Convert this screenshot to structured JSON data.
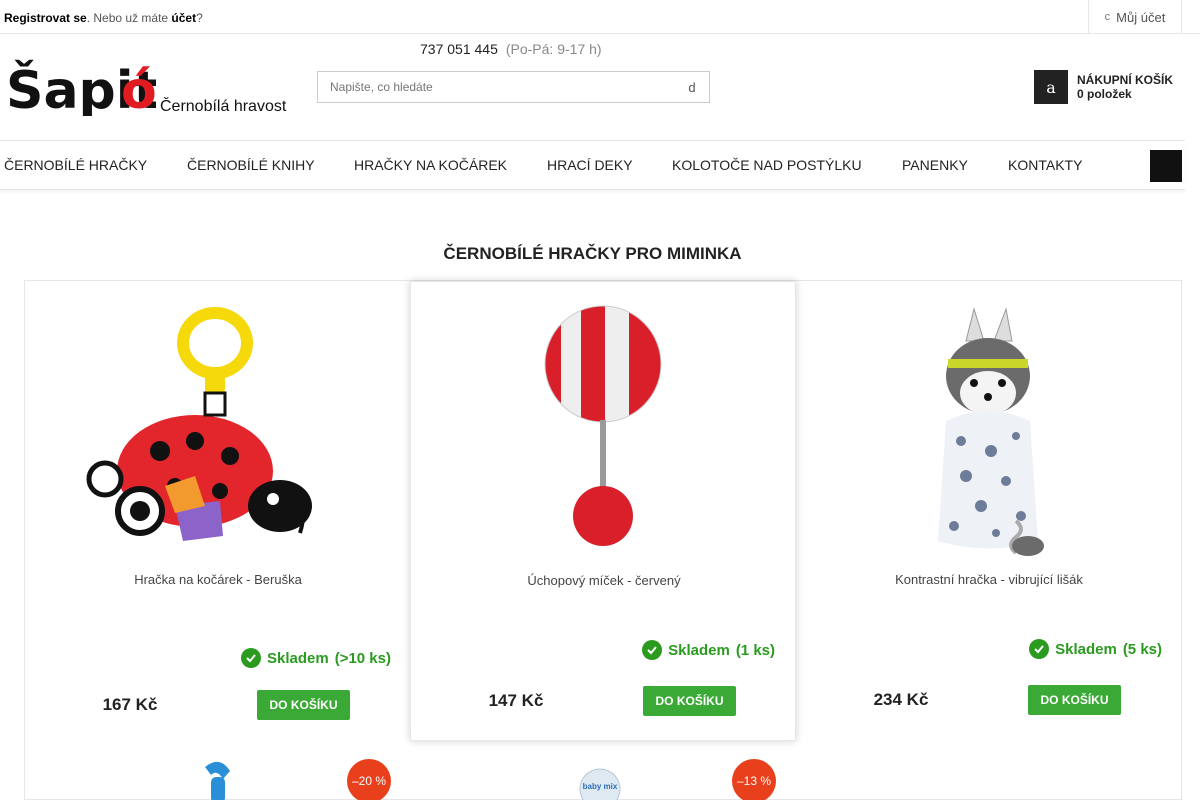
{
  "topbar": {
    "register_link": "Registrovat se",
    "middle_text": ". Nebo už máte ",
    "account_link": "účet",
    "end_text": "?",
    "my_account_icon": "c",
    "my_account": "Můj účet"
  },
  "header": {
    "phone_icon": "",
    "phone": "737 051 445",
    "hours": "(Po-Pá: 9-17 h)",
    "logo_tagline": "Černobílá hravost",
    "search_placeholder": "Napište, co hledáte",
    "search_icon_glyph": "d",
    "cart_icon_glyph": "a",
    "cart_title": "NÁKUPNÍ KOŠÍK",
    "cart_count": "0 položek"
  },
  "nav": {
    "items": [
      "ČERNOBÍLÉ HRAČKY",
      "ČERNOBÍLÉ KNIHY",
      "HRAČKY NA KOČÁREK",
      "HRACÍ DEKY",
      "KOLOTOČE NAD POSTÝLKU",
      "PANENKY",
      "KONTAKTY"
    ],
    "menu_glyph": ""
  },
  "section": {
    "title": "ČERNOBÍLÉ HRAČKY PRO MIMINKA"
  },
  "products": [
    {
      "name": "Hračka na kočárek - Beruška",
      "rating_glyphs": "",
      "stock_label": "Skladem",
      "stock_count": "(>10 ks)",
      "price": "167 Kč",
      "buy_label": "DO KOŠÍKU"
    },
    {
      "name": "Úchopový míček - červený",
      "rating_glyphs": "",
      "stock_label": "Skladem",
      "stock_count": "(1 ks)",
      "price": "147 Kč",
      "buy_label": "DO KOŠÍKU"
    },
    {
      "name": "Kontrastní hračka - vibrující lišák",
      "rating_glyphs": "",
      "stock_label": "Skladem",
      "stock_count": "(5 ks)",
      "price": "234 Kč",
      "buy_label": "DO KOŠÍKU"
    }
  ],
  "next_row": {
    "badges": [
      "–20 %",
      "–13 %"
    ],
    "thumb_text": "baby mix"
  },
  "colors": {
    "accent_green": "#3aa935",
    "stock_green": "#2a9b1f",
    "discount_red": "#e8401c",
    "brand_red": "#e11b22"
  }
}
